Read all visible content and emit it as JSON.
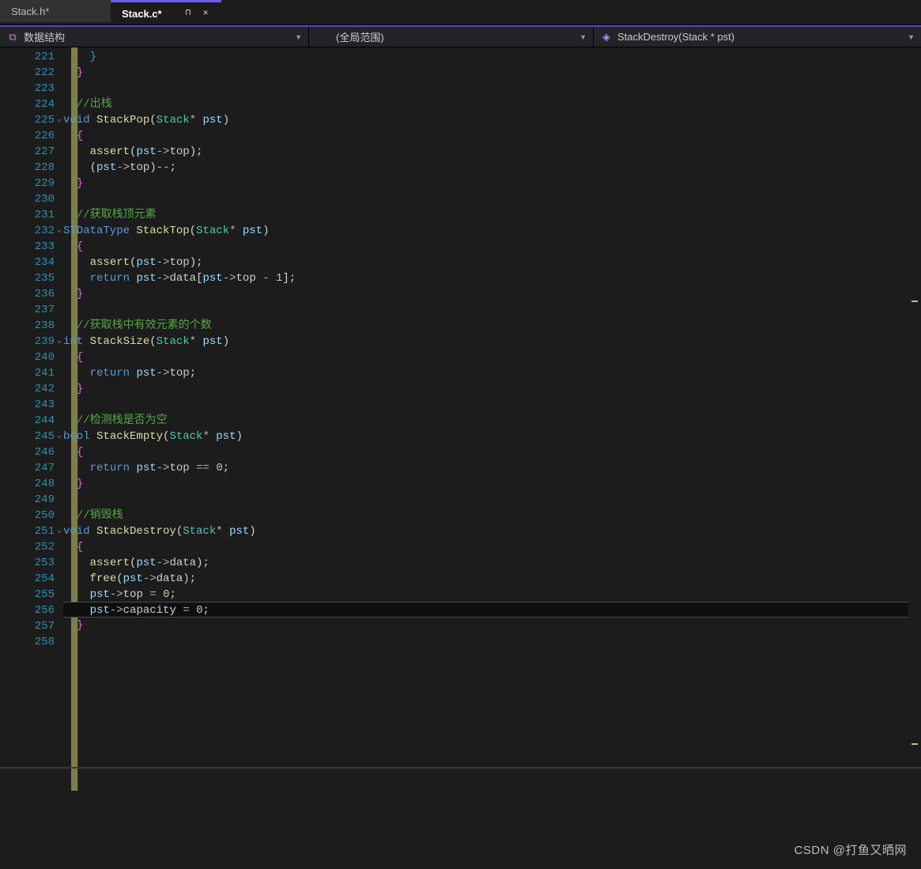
{
  "tabs": {
    "inactive": {
      "title": "Stack.h*"
    },
    "active": {
      "title": "Stack.c*"
    }
  },
  "toolbar": {
    "project": "数据结构",
    "scope": "(全局范围)",
    "symbol": "StackDestroy(Stack * pst)"
  },
  "line_start": 221,
  "line_end": 258,
  "code": [
    {
      "n": 221,
      "t": "ibrace",
      "txt": "}"
    },
    {
      "n": 222,
      "t": "brace",
      "txt": "}"
    },
    {
      "n": 223,
      "t": "blank",
      "txt": ""
    },
    {
      "n": 224,
      "t": "cmt",
      "txt": "//出栈"
    },
    {
      "n": 225,
      "t": "sig",
      "kw": "void",
      "fn": "StackPop",
      "ty": "Stack",
      "ptr": "*",
      "p": "pst",
      "fold": true
    },
    {
      "n": 226,
      "t": "brace",
      "txt": "{"
    },
    {
      "n": 227,
      "t": "assert_member",
      "m": "top"
    },
    {
      "n": 228,
      "t": "decr",
      "m": "top"
    },
    {
      "n": 229,
      "t": "brace",
      "txt": "}"
    },
    {
      "n": 230,
      "t": "blank",
      "txt": ""
    },
    {
      "n": 231,
      "t": "cmt",
      "txt": "//获取栈顶元素"
    },
    {
      "n": 232,
      "t": "sig",
      "kw": "STDataType",
      "fn": "StackTop",
      "ty": "Stack",
      "ptr": "*",
      "p": "pst",
      "fold": true
    },
    {
      "n": 233,
      "t": "brace",
      "txt": "{"
    },
    {
      "n": 234,
      "t": "assert_member",
      "m": "top"
    },
    {
      "n": 235,
      "t": "return_data"
    },
    {
      "n": 236,
      "t": "brace",
      "txt": "}"
    },
    {
      "n": 237,
      "t": "blank",
      "txt": ""
    },
    {
      "n": 238,
      "t": "cmt",
      "txt": "//获取栈中有效元素的个数"
    },
    {
      "n": 239,
      "t": "sig",
      "kw": "int",
      "fn": "StackSize",
      "ty": "Stack",
      "ptr": "*",
      "p": "pst",
      "fold": true
    },
    {
      "n": 240,
      "t": "brace",
      "txt": "{"
    },
    {
      "n": 241,
      "t": "return_member",
      "m": "top"
    },
    {
      "n": 242,
      "t": "brace",
      "txt": "}"
    },
    {
      "n": 243,
      "t": "blank",
      "txt": ""
    },
    {
      "n": 244,
      "t": "cmt",
      "txt": "//检测栈是否为空"
    },
    {
      "n": 245,
      "t": "sig",
      "kw": "bool",
      "fn": "StackEmpty",
      "ty": "Stack",
      "ptr": "*",
      "p": "pst",
      "fold": true
    },
    {
      "n": 246,
      "t": "brace",
      "txt": "{"
    },
    {
      "n": 247,
      "t": "return_eq",
      "m": "top",
      "v": "0"
    },
    {
      "n": 248,
      "t": "brace",
      "txt": "}"
    },
    {
      "n": 249,
      "t": "blank",
      "txt": ""
    },
    {
      "n": 250,
      "t": "cmt",
      "txt": "//销毁栈"
    },
    {
      "n": 251,
      "t": "sig",
      "kw": "void",
      "fn": "StackDestroy",
      "ty": "Stack",
      "ptr": "*",
      "p": "pst",
      "fold": true
    },
    {
      "n": 252,
      "t": "brace",
      "txt": "{"
    },
    {
      "n": 253,
      "t": "assert_member",
      "m": "data"
    },
    {
      "n": 254,
      "t": "free_member",
      "m": "data"
    },
    {
      "n": 255,
      "t": "assign",
      "m": "top",
      "v": "0"
    },
    {
      "n": 256,
      "t": "assign",
      "m": "capacity",
      "v": "0",
      "cur": true
    },
    {
      "n": 257,
      "t": "brace",
      "txt": "}"
    },
    {
      "n": 258,
      "t": "blank",
      "txt": ""
    }
  ],
  "watermark": "CSDN @打鱼又晒网"
}
